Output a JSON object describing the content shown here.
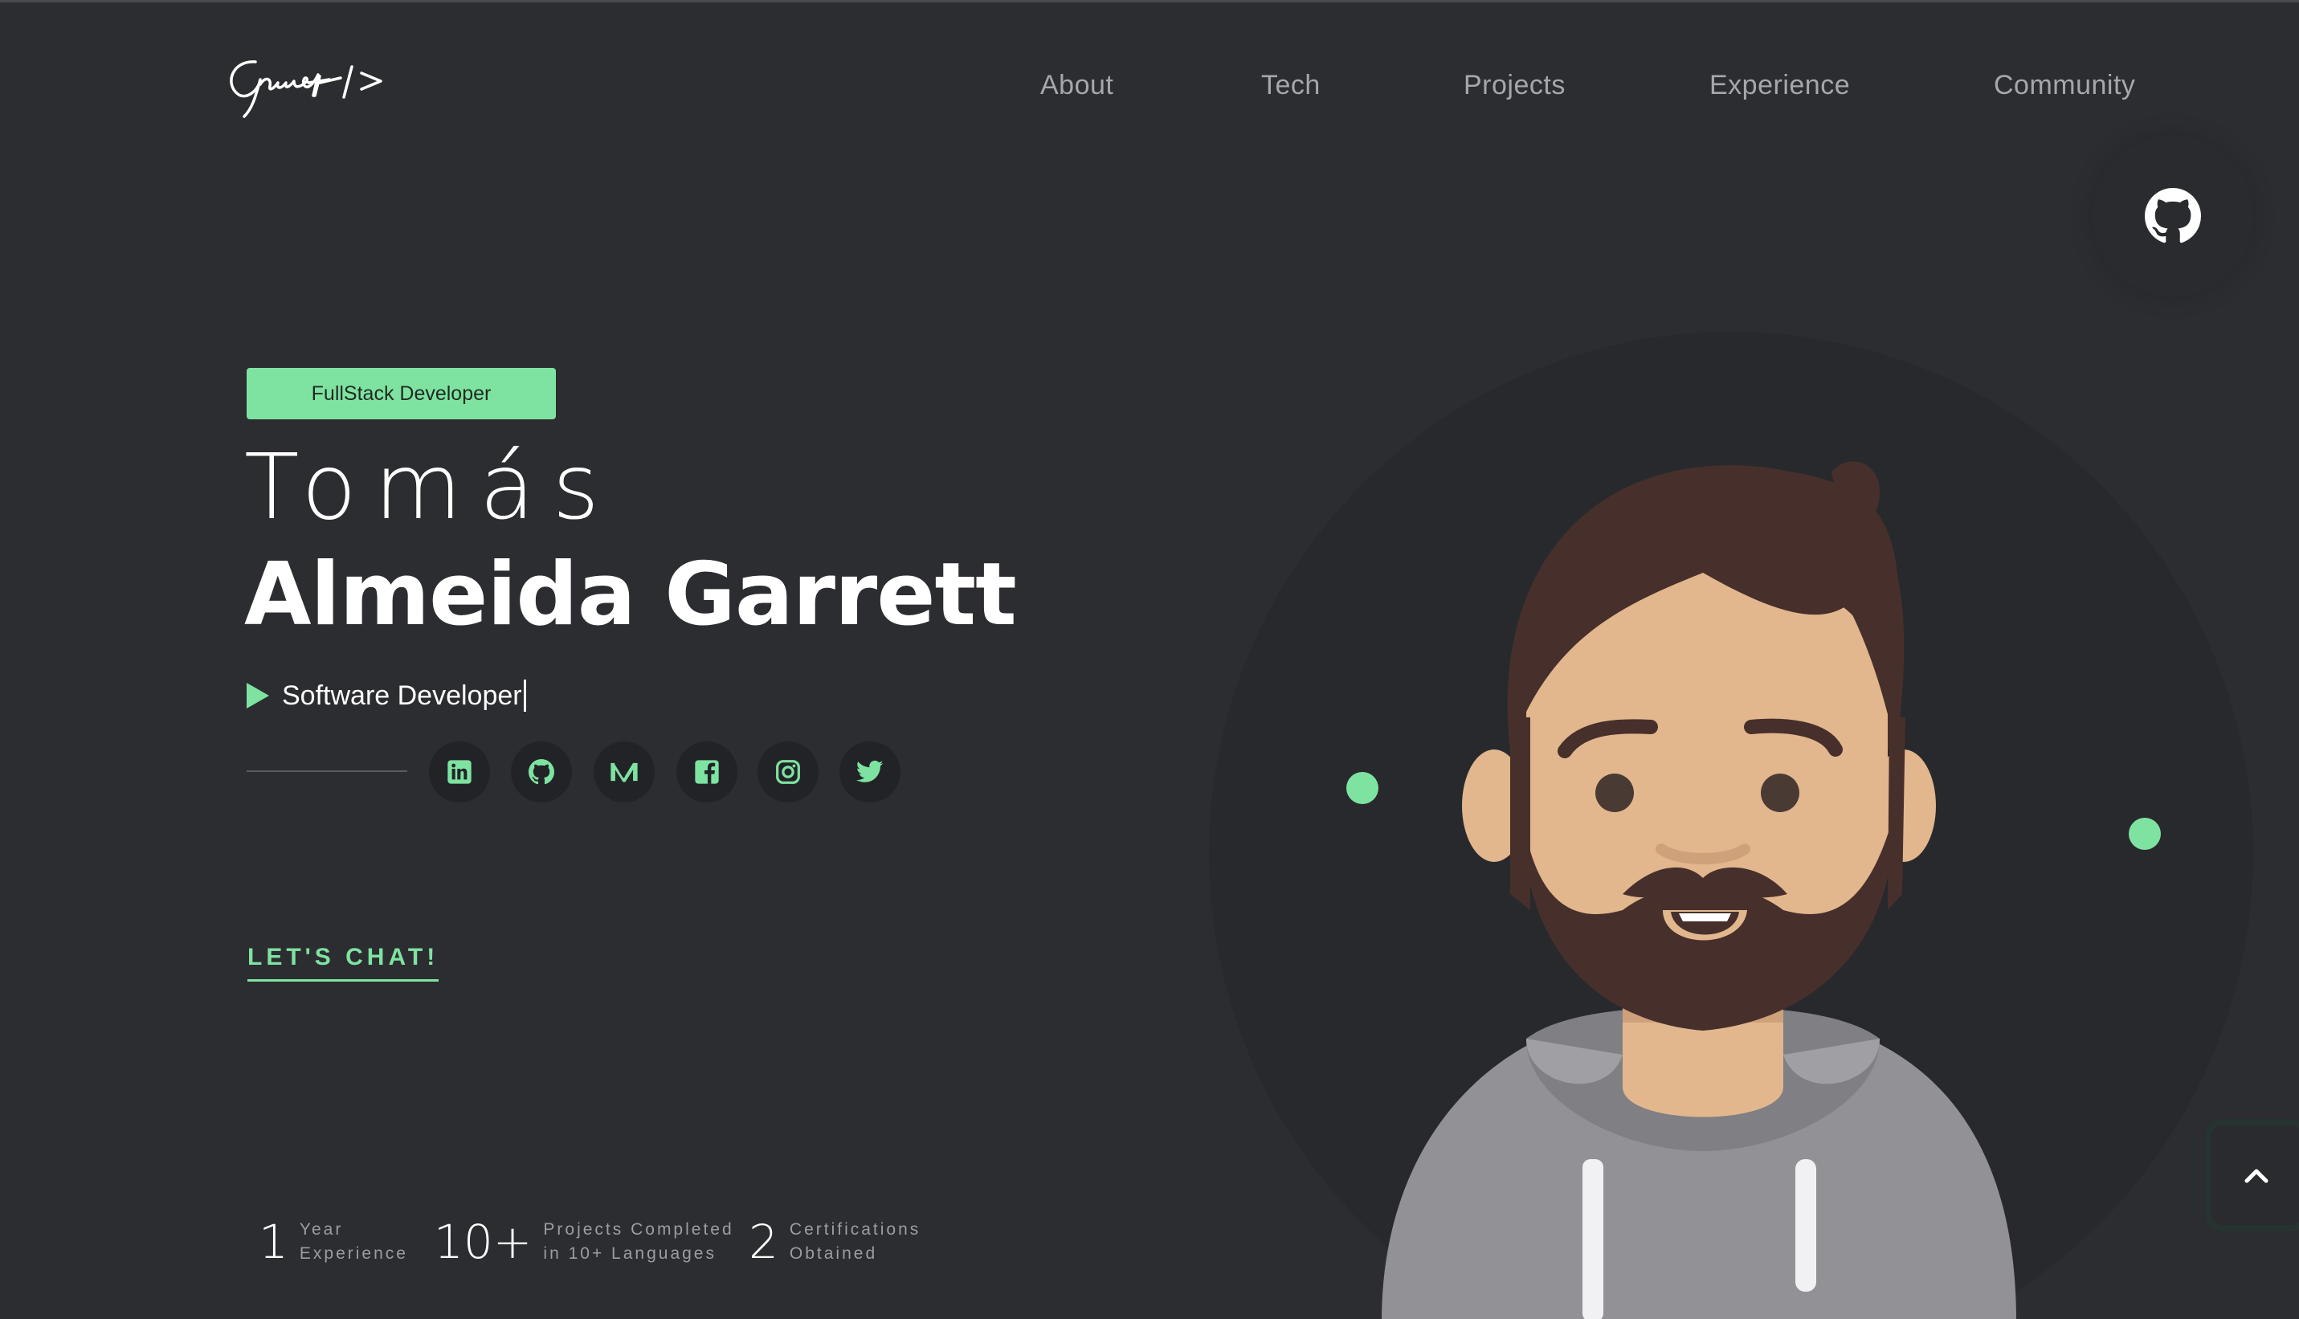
{
  "header": {
    "logo_text": "Garrett />",
    "nav": [
      {
        "label": "About"
      },
      {
        "label": "Tech"
      },
      {
        "label": "Projects"
      },
      {
        "label": "Experience"
      },
      {
        "label": "Community"
      }
    ]
  },
  "hero": {
    "badge": "FullStack Developer",
    "first_name": "Tomás",
    "last_name": "Almeida Garrett",
    "role": "Software Developer",
    "cta": "LET'S CHAT!",
    "social_icons": [
      "linkedin-icon",
      "github-icon",
      "medium-icon",
      "facebook-icon",
      "instagram-icon",
      "twitter-icon"
    ]
  },
  "stats": [
    {
      "number": "1",
      "label_line1": "Year",
      "label_line2": "Experience"
    },
    {
      "number": "10+",
      "label_line1": "Projects Completed",
      "label_line2": "in 10+ Languages"
    },
    {
      "number": "2",
      "label_line1": "Certifications",
      "label_line2": "Obtained"
    }
  ],
  "colors": {
    "background": "#2c2d31",
    "accent": "#7ee3a1",
    "nav_text": "#a6a7ab"
  }
}
